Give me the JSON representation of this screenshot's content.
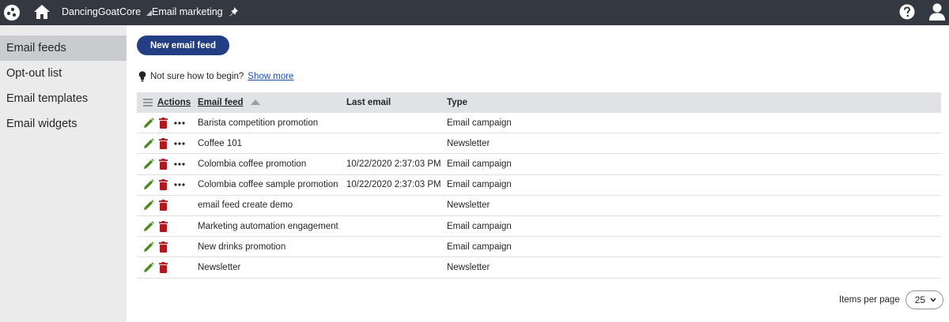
{
  "header": {
    "site_name": "DancingGoatCore",
    "app_name": "Email marketing"
  },
  "sidebar": {
    "items": [
      {
        "label": "Email feeds"
      },
      {
        "label": "Opt-out list"
      },
      {
        "label": "Email templates"
      },
      {
        "label": "Email widgets"
      }
    ]
  },
  "toolbar": {
    "new_label": "New email feed"
  },
  "hint": {
    "text": "Not sure how to begin?",
    "link": "Show more"
  },
  "table": {
    "headers": {
      "actions": "Actions",
      "feed": "Email feed",
      "last": "Last email",
      "type": "Type"
    },
    "rows": [
      {
        "feed": "Barista competition promotion",
        "last": "",
        "type": "Email campaign"
      },
      {
        "feed": "Coffee 101",
        "last": "",
        "type": "Newsletter"
      },
      {
        "feed": "Colombia coffee promotion",
        "last": "10/22/2020 2:37:03 PM",
        "type": "Email campaign"
      },
      {
        "feed": "Colombia coffee sample promotion",
        "last": "10/22/2020 2:37:03 PM",
        "type": "Email campaign"
      },
      {
        "feed": "email feed create demo",
        "last": "",
        "type": "Newsletter"
      },
      {
        "feed": "Marketing automation engagement",
        "last": "",
        "type": "Email campaign"
      },
      {
        "feed": "New drinks promotion",
        "last": "",
        "type": "Email campaign"
      },
      {
        "feed": "Newsletter",
        "last": "",
        "type": "Newsletter"
      }
    ]
  },
  "pager": {
    "label": "Items per page",
    "value": "25"
  },
  "colors": {
    "topbar": "#343841",
    "primary": "#243e83",
    "edit": "#4a8a1e",
    "delete": "#b0191e"
  },
  "icons": [
    "app-icon",
    "home-icon",
    "pin-icon",
    "help-icon",
    "user-icon",
    "bulb-icon",
    "list-icon",
    "edit-icon",
    "delete-icon",
    "more-icon",
    "chevron-down-icon"
  ]
}
